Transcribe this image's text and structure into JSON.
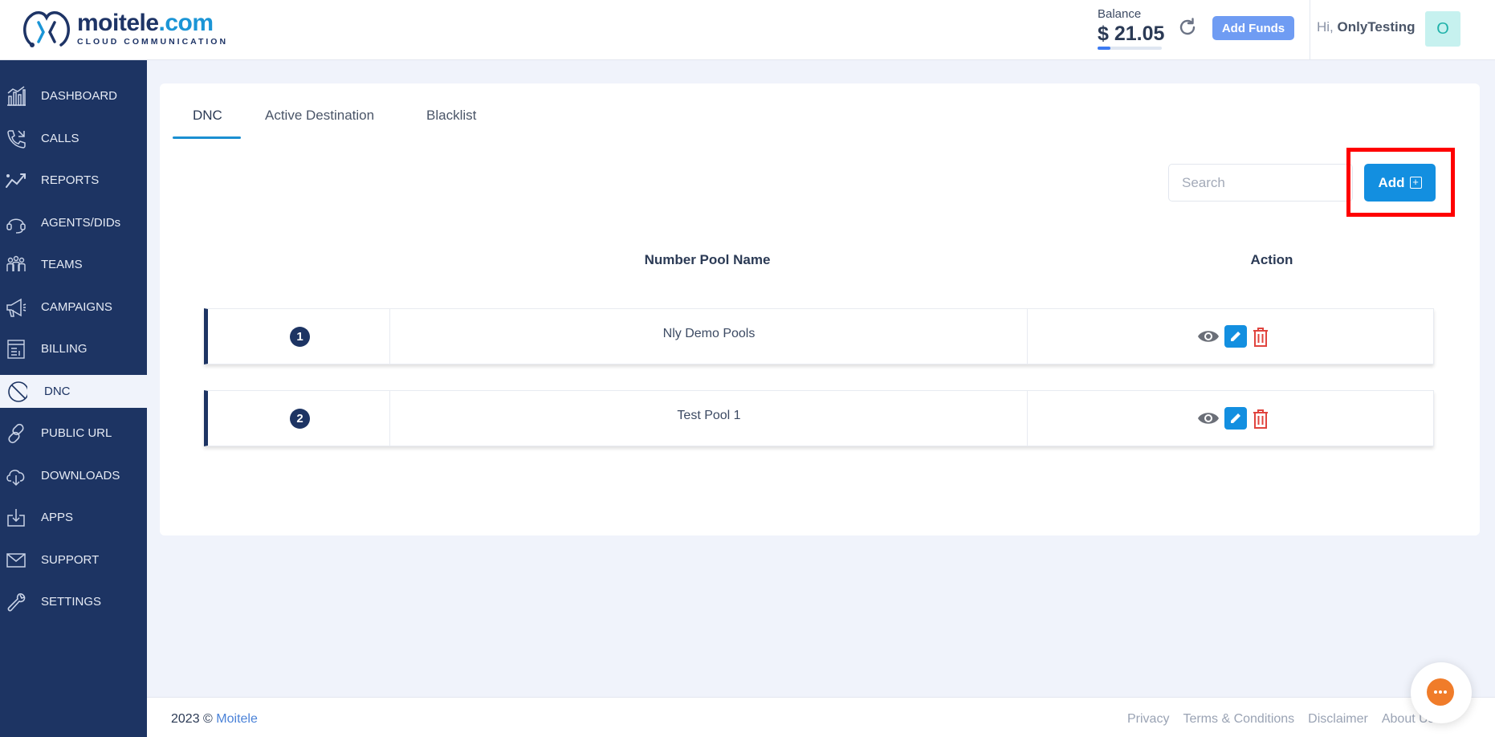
{
  "brand": {
    "name_main": "moitele",
    "name_dot": ".com",
    "tagline": "CLOUD COMMUNICATION",
    "primary_color": "#1d3463",
    "accent_color": "#138fe0"
  },
  "header": {
    "balance_label": "Balance",
    "balance_value": "$ 21.05",
    "balance_progress": 0.2,
    "refresh_icon": "refresh-icon",
    "add_funds_label": "Add Funds",
    "greeting_prefix": "Hi,",
    "user_name": "OnlyTesting",
    "avatar_initial": "O"
  },
  "sidebar": {
    "items": [
      {
        "label": "DASHBOARD",
        "icon": "dashboard-icon",
        "active": false
      },
      {
        "label": "CALLS",
        "icon": "phone-icon",
        "active": false
      },
      {
        "label": "REPORTS",
        "icon": "reports-icon",
        "active": false
      },
      {
        "label": "AGENTS/DIDs",
        "icon": "headset-icon",
        "active": false
      },
      {
        "label": "TEAMS",
        "icon": "teams-icon",
        "active": false
      },
      {
        "label": "CAMPAIGNS",
        "icon": "megaphone-icon",
        "active": false
      },
      {
        "label": "BILLING",
        "icon": "billing-icon",
        "active": false
      },
      {
        "label": "DNC",
        "icon": "block-icon",
        "active": true
      },
      {
        "label": "PUBLIC URL",
        "icon": "link-icon",
        "active": false
      },
      {
        "label": "DOWNLOADS",
        "icon": "cloud-download-icon",
        "active": false
      },
      {
        "label": "APPS",
        "icon": "apps-icon",
        "active": false
      },
      {
        "label": "SUPPORT",
        "icon": "mail-icon",
        "active": false
      },
      {
        "label": "SETTINGS",
        "icon": "wrench-icon",
        "active": false
      }
    ]
  },
  "main": {
    "tabs": [
      {
        "label": "DNC",
        "active": true
      },
      {
        "label": "Active Destination",
        "active": false
      },
      {
        "label": "Blacklist",
        "active": false
      }
    ],
    "search_placeholder": "Search",
    "add_label": "Add",
    "table": {
      "headers": [
        "Number Pool Name",
        "Action"
      ],
      "rows": [
        {
          "index": "1",
          "name": "Nly Demo Pools"
        },
        {
          "index": "2",
          "name": "Test Pool 1"
        }
      ]
    }
  },
  "footer": {
    "year": "2023 ©",
    "company": "Moitele",
    "links": [
      "Privacy",
      "Terms & Conditions",
      "Disclaimer",
      "About Us"
    ]
  }
}
